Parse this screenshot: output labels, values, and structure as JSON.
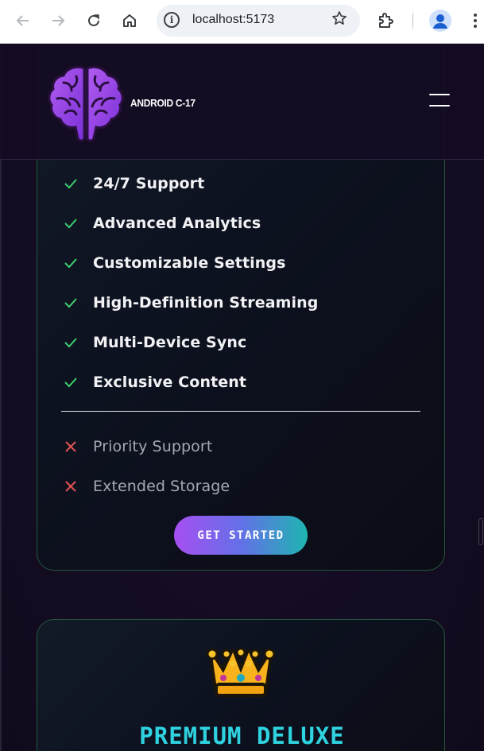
{
  "browser": {
    "url": "localhost:5173",
    "back_icon": "arrow-left-icon",
    "forward_icon": "arrow-right-icon",
    "reload_icon": "reload-icon",
    "home_icon": "home-icon",
    "bookmark_icon": "star-icon",
    "extensions_icon": "puzzle-icon",
    "profile_icon": "profile-icon",
    "menu_icon": "kebab-menu-icon"
  },
  "navbar": {
    "brand": "ANDROID C-17",
    "logo_icon": "brain-logo-icon",
    "menu_icon": "hamburger-icon"
  },
  "plan_card": {
    "included_features": [
      {
        "label": "24/7 Support"
      },
      {
        "label": "Advanced Analytics"
      },
      {
        "label": "Customizable Settings"
      },
      {
        "label": "High-Definition Streaming"
      },
      {
        "label": "Multi-Device Sync"
      },
      {
        "label": "Exclusive Content"
      }
    ],
    "excluded_features": [
      {
        "label": "Priority Support"
      },
      {
        "label": "Extended Storage"
      }
    ],
    "cta_label": "GET STARTED"
  },
  "next_plan": {
    "icon": "crown-icon",
    "title": "PREMIUM DELUXE"
  },
  "colors": {
    "check": "#3ecf6e",
    "cross": "#e05252",
    "title_cyan": "#2fd2e0",
    "card_border": "#24573d",
    "cta_gradient_start": "#a64ff1",
    "cta_gradient_end": "#1eb5b0"
  }
}
